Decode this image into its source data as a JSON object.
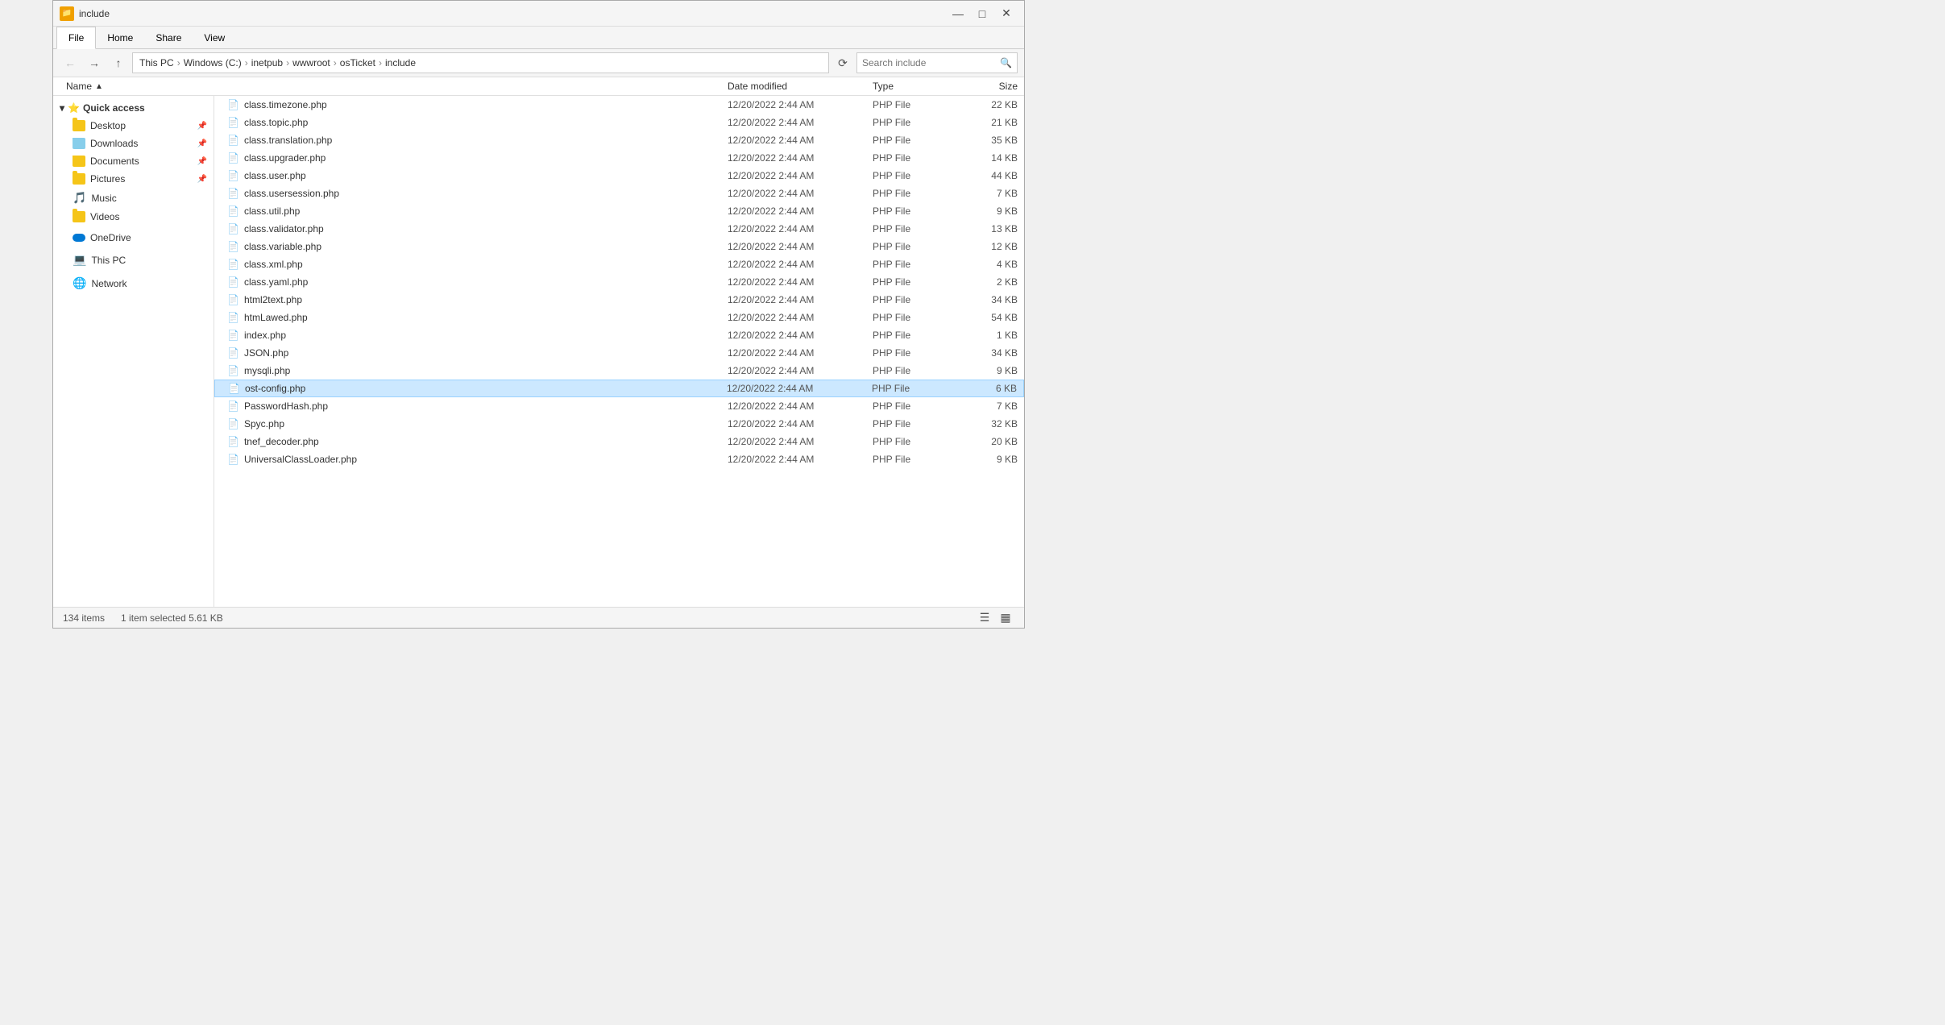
{
  "window": {
    "title": "include",
    "title_bar_icon": "📁"
  },
  "ribbon": {
    "tabs": [
      "File",
      "Home",
      "Share",
      "View"
    ],
    "active_tab": "File"
  },
  "address_bar": {
    "breadcrumbs": [
      "This PC",
      "Windows (C:)",
      "inetpub",
      "wwwroot",
      "osTicket",
      "include"
    ],
    "search_placeholder": "Search include",
    "search_value": ""
  },
  "columns": {
    "name": "Name",
    "date_modified": "Date modified",
    "type": "Type",
    "size": "Size"
  },
  "sidebar": {
    "sections": [
      {
        "label": "Quick access",
        "items": [
          {
            "name": "Desktop",
            "pinned": true
          },
          {
            "name": "Downloads",
            "pinned": true
          },
          {
            "name": "Documents",
            "pinned": true
          },
          {
            "name": "Pictures",
            "pinned": true
          },
          {
            "name": "Music",
            "pinned": false
          },
          {
            "name": "Videos",
            "pinned": false
          }
        ]
      },
      {
        "label": "OneDrive",
        "items": []
      },
      {
        "label": "This PC",
        "items": []
      },
      {
        "label": "Network",
        "items": []
      }
    ]
  },
  "files": [
    {
      "name": "class.timezone.php",
      "date": "12/20/2022 2:44 AM",
      "type": "PHP File",
      "size": "22 KB"
    },
    {
      "name": "class.topic.php",
      "date": "12/20/2022 2:44 AM",
      "type": "PHP File",
      "size": "21 KB"
    },
    {
      "name": "class.translation.php",
      "date": "12/20/2022 2:44 AM",
      "type": "PHP File",
      "size": "35 KB"
    },
    {
      "name": "class.upgrader.php",
      "date": "12/20/2022 2:44 AM",
      "type": "PHP File",
      "size": "14 KB"
    },
    {
      "name": "class.user.php",
      "date": "12/20/2022 2:44 AM",
      "type": "PHP File",
      "size": "44 KB"
    },
    {
      "name": "class.usersession.php",
      "date": "12/20/2022 2:44 AM",
      "type": "PHP File",
      "size": "7 KB"
    },
    {
      "name": "class.util.php",
      "date": "12/20/2022 2:44 AM",
      "type": "PHP File",
      "size": "9 KB"
    },
    {
      "name": "class.validator.php",
      "date": "12/20/2022 2:44 AM",
      "type": "PHP File",
      "size": "13 KB"
    },
    {
      "name": "class.variable.php",
      "date": "12/20/2022 2:44 AM",
      "type": "PHP File",
      "size": "12 KB"
    },
    {
      "name": "class.xml.php",
      "date": "12/20/2022 2:44 AM",
      "type": "PHP File",
      "size": "4 KB"
    },
    {
      "name": "class.yaml.php",
      "date": "12/20/2022 2:44 AM",
      "type": "PHP File",
      "size": "2 KB"
    },
    {
      "name": "html2text.php",
      "date": "12/20/2022 2:44 AM",
      "type": "PHP File",
      "size": "34 KB"
    },
    {
      "name": "htmLawed.php",
      "date": "12/20/2022 2:44 AM",
      "type": "PHP File",
      "size": "54 KB"
    },
    {
      "name": "index.php",
      "date": "12/20/2022 2:44 AM",
      "type": "PHP File",
      "size": "1 KB"
    },
    {
      "name": "JSON.php",
      "date": "12/20/2022 2:44 AM",
      "type": "PHP File",
      "size": "34 KB"
    },
    {
      "name": "mysqli.php",
      "date": "12/20/2022 2:44 AM",
      "type": "PHP File",
      "size": "9 KB"
    },
    {
      "name": "ost-config.php",
      "date": "12/20/2022 2:44 AM",
      "type": "PHP File",
      "size": "6 KB",
      "selected": true
    },
    {
      "name": "PasswordHash.php",
      "date": "12/20/2022 2:44 AM",
      "type": "PHP File",
      "size": "7 KB"
    },
    {
      "name": "Spyc.php",
      "date": "12/20/2022 2:44 AM",
      "type": "PHP File",
      "size": "32 KB"
    },
    {
      "name": "tnef_decoder.php",
      "date": "12/20/2022 2:44 AM",
      "type": "PHP File",
      "size": "20 KB"
    },
    {
      "name": "UniversalClassLoader.php",
      "date": "12/20/2022 2:44 AM",
      "type": "PHP File",
      "size": "9 KB"
    }
  ],
  "status": {
    "item_count": "134 items",
    "selection": "1 item selected  5.61 KB"
  },
  "colors": {
    "selected_bg": "#cce8ff",
    "selected_border": "#99d1ff",
    "accent": "#0078d4"
  }
}
